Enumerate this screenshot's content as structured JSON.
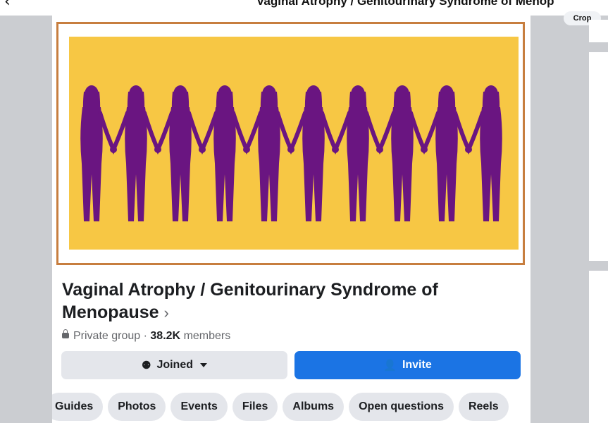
{
  "topbar": {
    "back_icon": "chevron-left-icon",
    "title": "Vaginal Atrophy / Genitourinary Syndrome of Menop",
    "crop_label": "Crop"
  },
  "cover": {
    "background_color": "#f7c744",
    "silhouette_color": "#6a1581",
    "border_color": "#c77e3f"
  },
  "group": {
    "name": "Vaginal Atrophy / Genitourinary Syndrome of Menopause",
    "chevron": "›",
    "privacy": "Private group",
    "separator": "·",
    "member_count": "38.2K",
    "members_label": "members"
  },
  "actions": {
    "joined_label": "Joined",
    "invite_label": "Invite"
  },
  "tabs": [
    "Guides",
    "Photos",
    "Events",
    "Files",
    "Albums",
    "Open questions",
    "Reels"
  ]
}
